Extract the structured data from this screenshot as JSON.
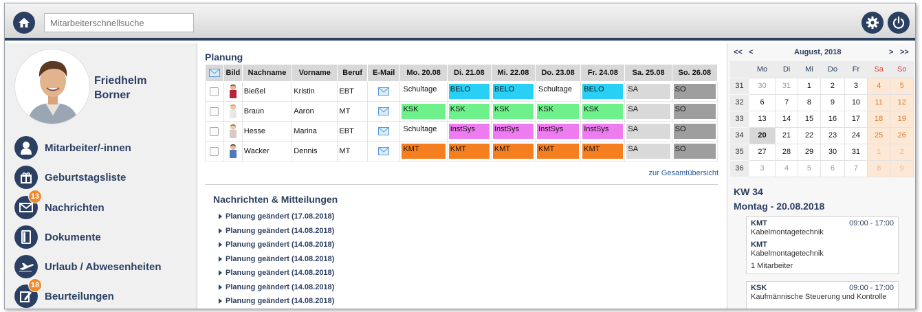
{
  "header": {
    "search_placeholder": "Mitarbeiterschnellsuche"
  },
  "user": {
    "first_name": "Friedhelm",
    "last_name": "Borner"
  },
  "nav": {
    "items": [
      {
        "label": "Mitarbeiter/-innen",
        "icon": "person-icon"
      },
      {
        "label": "Geburtstagsliste",
        "icon": "gift-icon"
      },
      {
        "label": "Nachrichten",
        "icon": "envelope-icon",
        "badge": "13"
      },
      {
        "label": "Dokumente",
        "icon": "document-icon"
      },
      {
        "label": "Urlaub / Abwesenheiten",
        "icon": "airplane-icon"
      },
      {
        "label": "Beurteilungen",
        "icon": "edit-icon",
        "badge": "18"
      }
    ]
  },
  "planning": {
    "title": "Planung",
    "columns": [
      "Bild",
      "Nachname",
      "Vorname",
      "Beruf",
      "E-Mail",
      "Mo. 20.08",
      "Di. 21.08",
      "Mi. 22.08",
      "Do. 23.08",
      "Fr. 24.08",
      "Sa. 25.08",
      "So. 26.08"
    ],
    "rows": [
      {
        "nachname": "Bießel",
        "vorname": "Kristin",
        "beruf": "EBT",
        "days": [
          "Schultage",
          "BELO",
          "BELO",
          "Schultage",
          "BELO",
          "SA",
          "SO"
        ]
      },
      {
        "nachname": "Braun",
        "vorname": "Aaron",
        "beruf": "MT",
        "days": [
          "KSK",
          "KSK",
          "KSK",
          "KSK",
          "KSK",
          "SA",
          "SO"
        ]
      },
      {
        "nachname": "Hesse",
        "vorname": "Marina",
        "beruf": "EBT",
        "days": [
          "Schultage",
          "InstSys",
          "InstSys",
          "InstSys",
          "InstSys",
          "SA",
          "SO"
        ]
      },
      {
        "nachname": "Wacker",
        "vorname": "Dennis",
        "beruf": "MT",
        "days": [
          "KMT",
          "KMT",
          "KMT",
          "KMT",
          "KMT",
          "SA",
          "SO"
        ]
      }
    ],
    "slot_colors": {
      "BELO": "#29d0f5",
      "KSK": "#6ef08a",
      "InstSys": "#ee7cf0",
      "KMT": "#f57f1f",
      "SA": "#d9d9d9",
      "SO": "#9e9e9e",
      "Schultage": "#ffffff"
    },
    "overview_link": "zur Gesamtübersicht"
  },
  "messages": {
    "title": "Nachrichten & Mitteilungen",
    "items": [
      "Planung geändert (17.08.2018)",
      "Planung geändert (14.08.2018)",
      "Planung geändert (14.08.2018)",
      "Planung geändert (14.08.2018)",
      "Planung geändert (14.08.2018)",
      "Planung geändert (14.08.2018)",
      "Planung geändert (14.08.2018)"
    ]
  },
  "calendar": {
    "nav_prev_year": "<<",
    "nav_prev": "<",
    "month_label": "August, 2018",
    "nav_next": ">",
    "nav_next_year": ">>",
    "weekdays": [
      "Mo",
      "Di",
      "Mi",
      "Do",
      "Fr",
      "Sa",
      "So"
    ],
    "weeks": [
      {
        "kw": "31",
        "days": [
          "30",
          "31",
          "1",
          "2",
          "3",
          "4",
          "5"
        ]
      },
      {
        "kw": "32",
        "days": [
          "6",
          "7",
          "8",
          "9",
          "10",
          "11",
          "12"
        ]
      },
      {
        "kw": "33",
        "days": [
          "13",
          "14",
          "15",
          "16",
          "17",
          "18",
          "19"
        ]
      },
      {
        "kw": "34",
        "days": [
          "20",
          "21",
          "22",
          "23",
          "24",
          "25",
          "26"
        ]
      },
      {
        "kw": "35",
        "days": [
          "27",
          "28",
          "29",
          "30",
          "31",
          "1",
          "2"
        ]
      },
      {
        "kw": "36",
        "days": [
          "3",
          "4",
          "5",
          "6",
          "7",
          "8",
          "9"
        ]
      }
    ],
    "selected_day": "20",
    "kw_label": "KW 34",
    "date_label": "Montag - 20.08.2018",
    "events": [
      {
        "code": "KMT",
        "time": "09:00 - 17:00",
        "desc": "Kabelmontagetechnik",
        "code2": "KMT",
        "desc2": "Kabelmontagetechnik",
        "count": "1 Mitarbeiter"
      },
      {
        "code": "KSK",
        "time": "09:00 - 17:00",
        "desc": "Kaufmännische Steuerung und Kontrolle"
      }
    ]
  }
}
